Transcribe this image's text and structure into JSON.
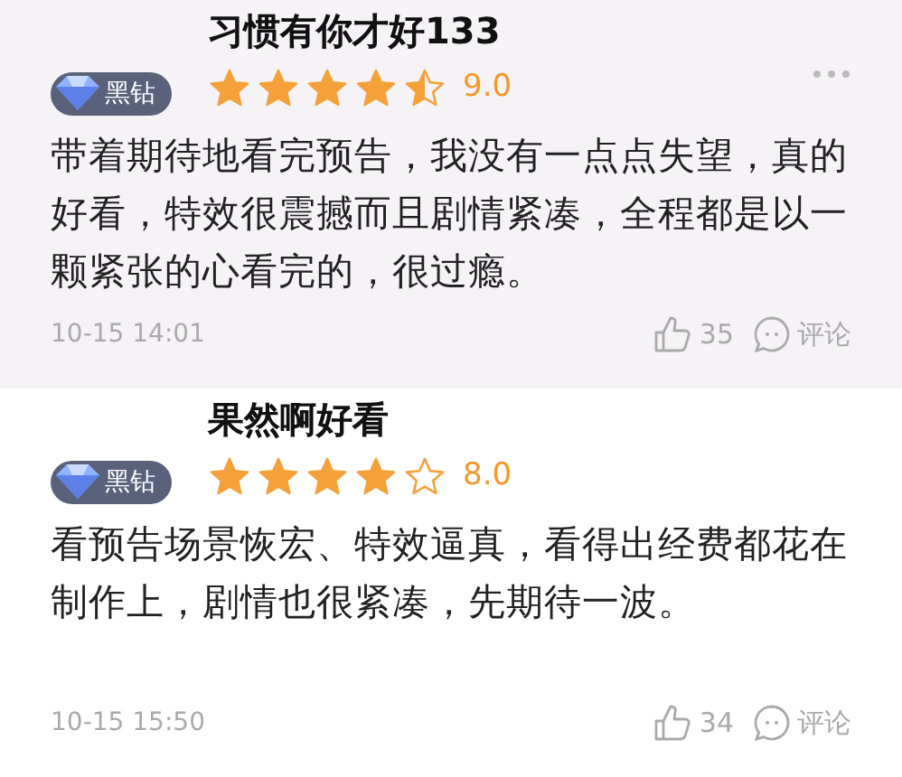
{
  "reviews": [
    {
      "username": "习惯有你才好133",
      "badge": "黑钻",
      "stars": 4.5,
      "score": "9.0",
      "more": true,
      "text": "带着期待地看完预告，我没有一点点失望，真的好看，特效很震撼而且剧情紧凑，全程都是以一颗紧张的心看完的，很过瘾。",
      "time": "10-15 14:01",
      "likes": "35",
      "comment_label": "评论",
      "highlighted": true
    },
    {
      "username": "果然啊好看",
      "badge": "黑钻",
      "stars": 4,
      "score": "8.0",
      "more": false,
      "text": "看预告场景恢宏、特效逼真，看得出经费都花在制作上，剧情也很紧凑，先期待一波。",
      "time": "10-15 15:50",
      "likes": "34",
      "comment_label": "评论",
      "highlighted": false
    }
  ]
}
